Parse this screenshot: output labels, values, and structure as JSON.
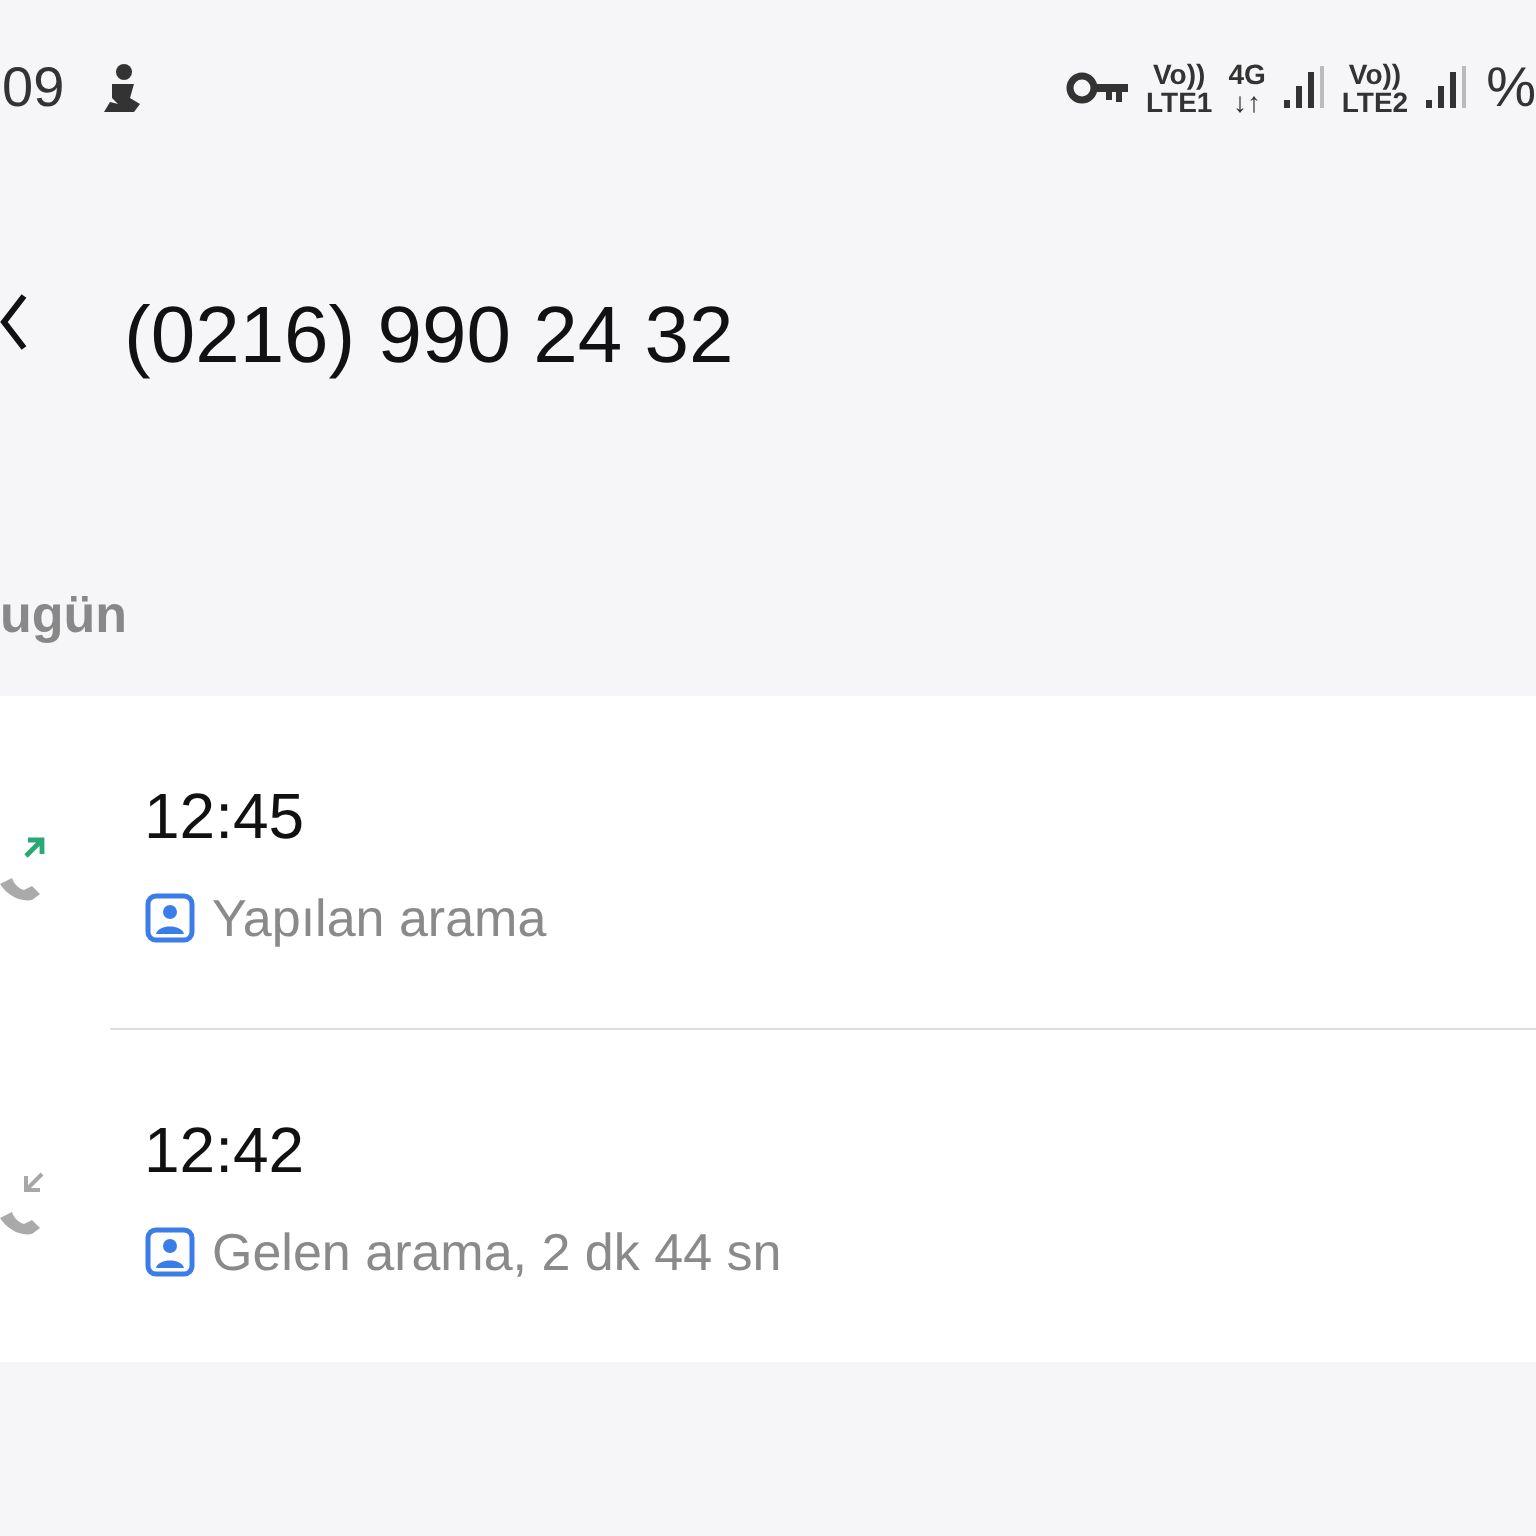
{
  "status_bar": {
    "time": "09",
    "right": [
      {
        "kind": "key"
      },
      {
        "kind": "stack",
        "top": "Vo))",
        "bottom": "LTE1"
      },
      {
        "kind": "stack",
        "top": "4G",
        "bottom": "↓↑"
      },
      {
        "kind": "signal"
      },
      {
        "kind": "stack",
        "top": "Vo))",
        "bottom": "LTE2"
      },
      {
        "kind": "signal"
      },
      {
        "kind": "text",
        "text": "%"
      }
    ]
  },
  "header": {
    "title": "(0216) 990 24 32"
  },
  "section": {
    "label": "ugün"
  },
  "calls": [
    {
      "time": "12:45",
      "description": "Yapılan arama",
      "kind": "outgoing",
      "color": "#2aa876"
    },
    {
      "time": "12:42",
      "description": "Gelen arama, 2 dk 44 sn",
      "kind": "incoming",
      "color": "#a8a8a8"
    }
  ]
}
